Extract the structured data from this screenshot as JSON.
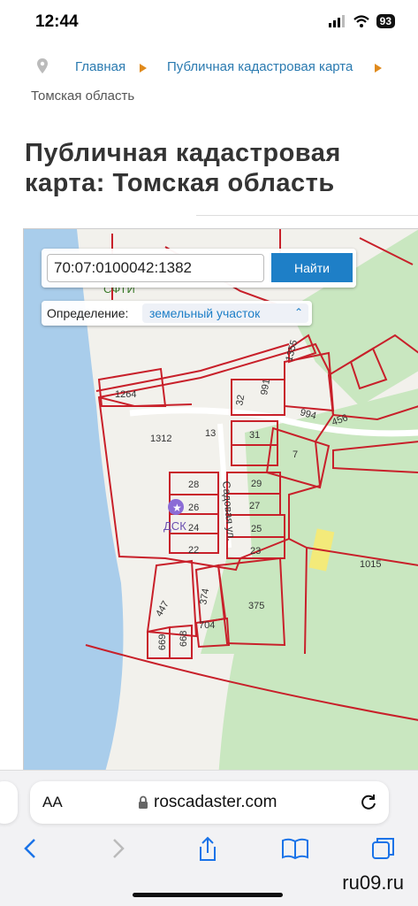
{
  "status": {
    "time": "12:44",
    "battery": "93"
  },
  "breadcrumb": {
    "home": "Главная",
    "map": "Публичная кадастровая карта",
    "current": "Томская область",
    "separator": "▸"
  },
  "page": {
    "title": "Публичная кадастровая карта: Томская область"
  },
  "map": {
    "search_value": "70:07:0100042:1382",
    "search_button": "Найти",
    "definition_label": "Определение:",
    "definition_value": "земельный участок",
    "street_label": "Садовая ул.",
    "poi_sfti": "СФТИ",
    "poi_dsk": "ДСК",
    "parcels": [
      "1355",
      "1264",
      "32",
      "991",
      "994",
      "456",
      "1312",
      "13",
      "31",
      "7",
      "28",
      "29",
      "26",
      "27",
      "24",
      "25",
      "22",
      "23",
      "1015",
      "374",
      "375",
      "447",
      "704",
      "669",
      "668"
    ]
  },
  "browser": {
    "aa": "AA",
    "url": "roscadaster.com"
  },
  "watermark": "ru09.ru",
  "colors": {
    "accent": "#1e7fc7",
    "parcel": "#c8202a",
    "water": "#a9cdeb",
    "forest": "#c9e7c0"
  }
}
